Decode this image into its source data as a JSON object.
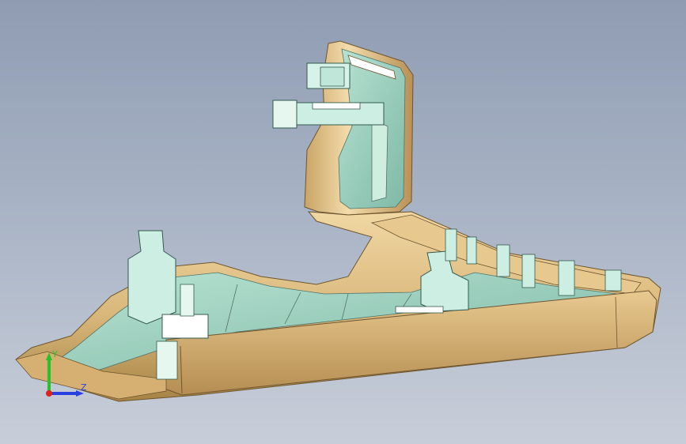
{
  "viewport": {
    "background_top": "#8f9cb2",
    "background_bottom": "#c8ced9"
  },
  "part": {
    "shell_color": "#d9b77a",
    "shell_shadow": "#a68345",
    "inner_color": "#9fd3c0",
    "rib_color": "#cfeee0"
  },
  "triad": {
    "x_label": "",
    "y_label": "Y",
    "z_label": "Z",
    "x_color": "#e0201c",
    "y_color": "#2bbf2b",
    "z_color": "#2a3fe0"
  }
}
